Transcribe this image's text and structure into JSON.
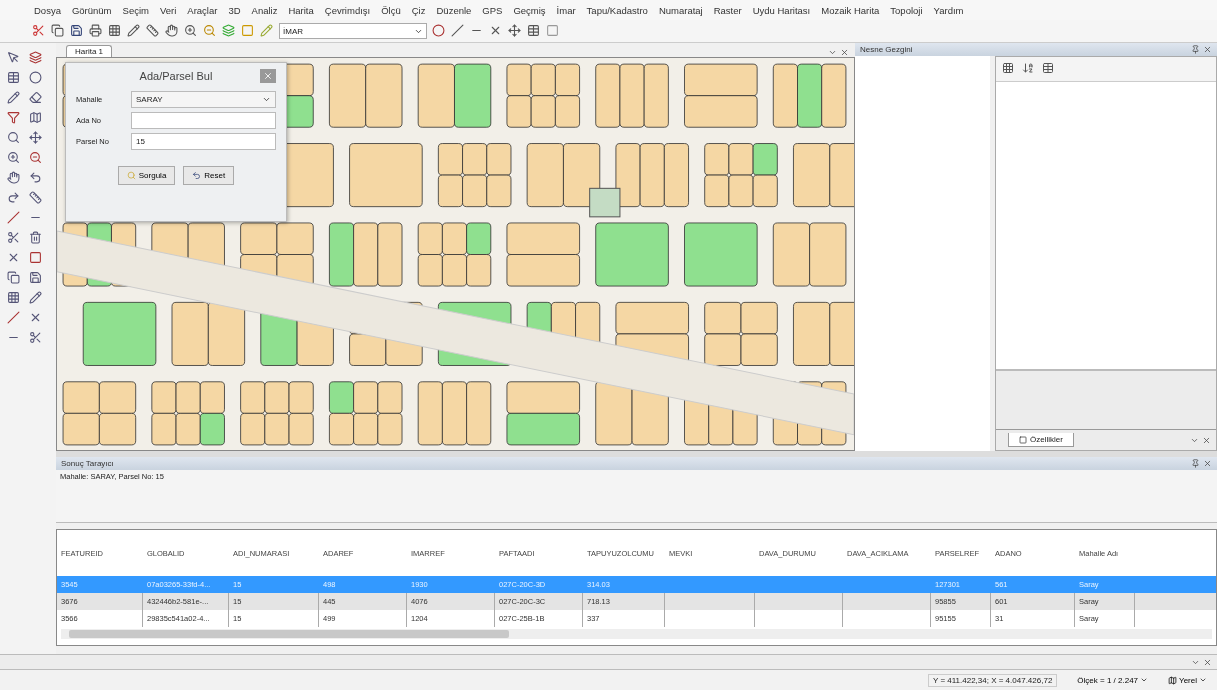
{
  "menu": [
    "Dosya",
    "Görünüm",
    "Seçim",
    "Veri",
    "Araçlar",
    "3D",
    "Analiz",
    "Harita",
    "Çevrimdışı",
    "Ölçü",
    "Çiz",
    "Düzenle",
    "GPS",
    "Geçmiş",
    "İmar",
    "Tapu/Kadastro",
    "Numarataj",
    "Raster",
    "Uydu Haritası",
    "Mozaik Harita",
    "Topoloji",
    "Yardım"
  ],
  "toolbar": {
    "layer_combo": "İMAR"
  },
  "map_tab": {
    "label": "Harita 1",
    "selected": true
  },
  "find_dialog": {
    "title": "Ada/Parsel Bul",
    "fields": [
      {
        "label": "Mahalle",
        "kind": "combo",
        "value": "SARAY"
      },
      {
        "label": "Ada No",
        "kind": "text"
      },
      {
        "label": "Parsel No",
        "kind": "text",
        "value": "15"
      }
    ],
    "buttons": [
      "Sorgula",
      "Reset"
    ]
  },
  "object_browser": {
    "title": "Nesne Gezgini"
  },
  "properties": {
    "tab": "Özellikler"
  },
  "results": {
    "title": "Sonuç Tarayıcı",
    "query": "Mahalle: SARAY, Parsel No: 15",
    "columns": [
      "FEATUREID",
      "GLOBALID",
      "ADI_NUMARASI",
      "ADAREF",
      "IMARREF",
      "PAFTAADI",
      "TAPUYUZOLCUMU",
      "MEVKI",
      "DAVA_DURUMU",
      "DAVA_ACIKLAMA",
      "PARSELREF",
      "ADANO",
      "Mahalle Adı"
    ],
    "rows": [
      {
        "selected": true,
        "cells": [
          "3545",
          "07a03265-33fd-4...",
          "15",
          "498",
          "1930",
          "027C-20C-3D",
          "314.03",
          null,
          null,
          null,
          "127301",
          "561",
          "Saray"
        ]
      },
      {
        "selected": false,
        "cells": [
          "3676",
          "432446b2-581e-...",
          "15",
          "445",
          "4076",
          "027C-20C-3C",
          "718.13",
          null,
          null,
          null,
          "95855",
          "601",
          "Saray"
        ]
      },
      {
        "selected": false,
        "cells": [
          "3566",
          "29835c541a02-4...",
          "15",
          "499",
          "1204",
          "027C-25B-1B",
          "337",
          null,
          null,
          null,
          "95155",
          "31",
          "Saray"
        ]
      }
    ]
  },
  "status_bar": {
    "coordinates": "Y = 411.422,34; X = 4.047.426,72",
    "scale": "Ölçek = 1 / 2.247",
    "projection": "Yerel"
  }
}
